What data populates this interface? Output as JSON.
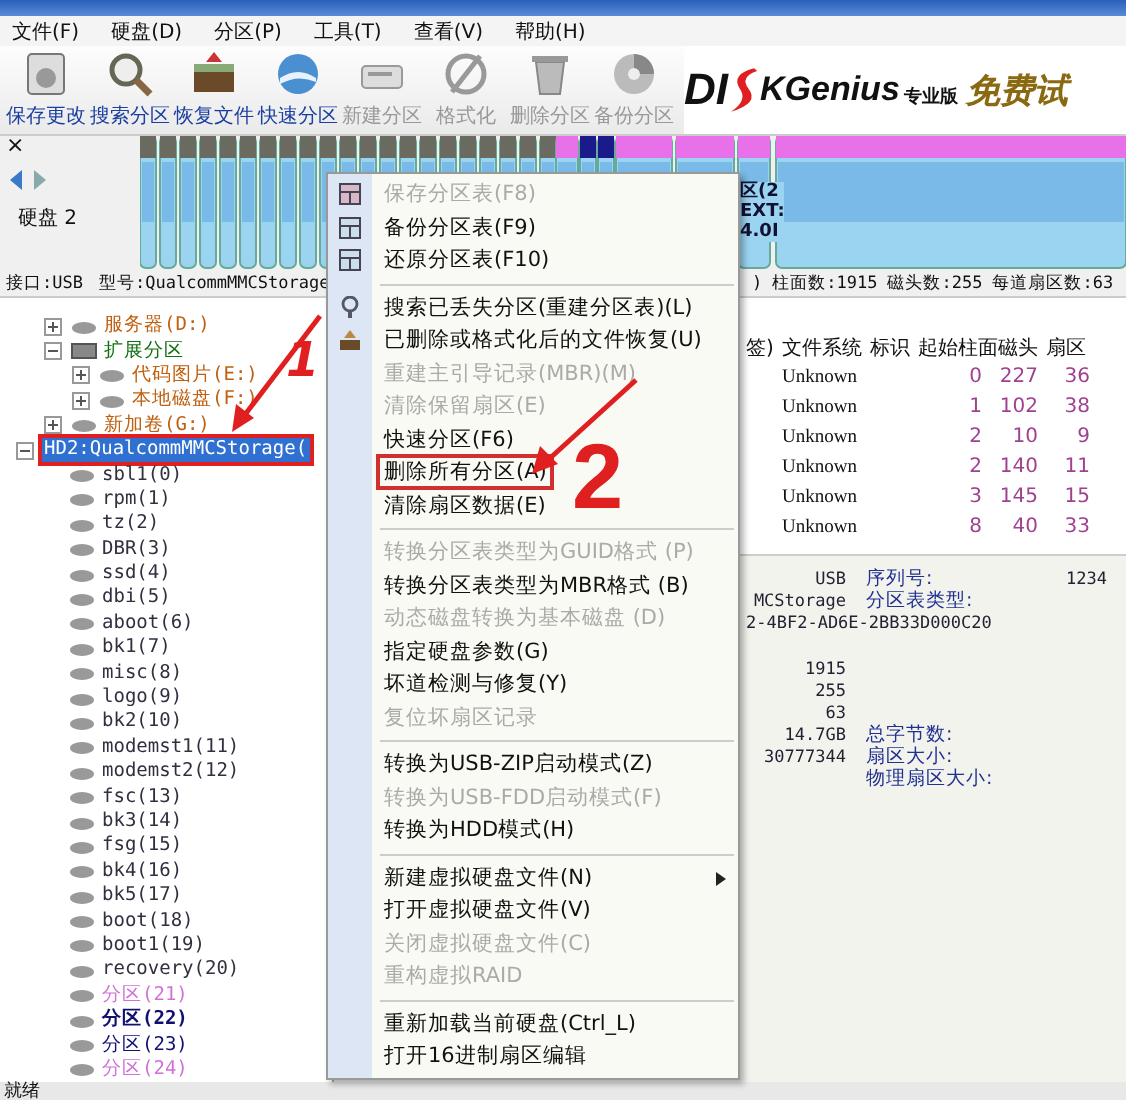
{
  "menubar": [
    "文件(F)",
    "硬盘(D)",
    "分区(P)",
    "工具(T)",
    "查看(V)",
    "帮助(H)"
  ],
  "toolbar": [
    {
      "label": "保存更改",
      "disabled": false
    },
    {
      "label": "搜索分区",
      "disabled": false
    },
    {
      "label": "恢复文件",
      "disabled": false
    },
    {
      "label": "快速分区",
      "disabled": false
    },
    {
      "label": "新建分区",
      "disabled": true
    },
    {
      "label": "格式化",
      "disabled": true
    },
    {
      "label": "删除分区",
      "disabled": true
    },
    {
      "label": "备份分区",
      "disabled": true
    }
  ],
  "logo": {
    "part_1": "DI",
    "part_2": "KGenius",
    "edition": "专业版",
    "badge": "免费试"
  },
  "disk_bar": {
    "close": "×",
    "disk_label": "硬盘 2",
    "segment_label": [
      "区(2",
      "EXT:",
      "4.0I"
    ]
  },
  "info_line": {
    "interface": "接口:USB",
    "model": "型号:QualcommMMCStorage",
    "fragment": ")",
    "cylinders": "柱面数:1915",
    "heads": "磁头数:255",
    "sectors": "每道扇区数:63"
  },
  "tree": {
    "partial_items": [
      {
        "label": "服务器(D:)",
        "color": "#c06010",
        "selected": false,
        "boxed": false,
        "expanded": false
      },
      {
        "label": "扩展分区",
        "color": "#107010",
        "selected": false,
        "boxed": false,
        "expanded": true,
        "children": [
          {
            "label": "代码图片(E:)",
            "color": "#c06010",
            "selected": false,
            "boxed": false,
            "expanded": false
          },
          {
            "label": "本地磁盘(F:)",
            "color": "#c06010",
            "selected": false,
            "boxed": false,
            "expanded": false
          }
        ]
      },
      {
        "label": "新加卷(G:)",
        "color": "#c06010",
        "selected": false,
        "boxed": false,
        "expanded": false
      }
    ],
    "disks": [
      {
        "label": "HD2:QualcommMMCStorage(",
        "selected": true,
        "boxed": true,
        "expanded": true,
        "children": [
          {
            "label": "sbl1(0)",
            "color": "#303040",
            "selected": false,
            "boxed": false
          },
          {
            "label": "rpm(1)",
            "color": "#303040",
            "selected": false,
            "boxed": false
          },
          {
            "label": "tz(2)",
            "color": "#303040",
            "selected": false,
            "boxed": false
          },
          {
            "label": "DBR(3)",
            "color": "#303040",
            "selected": false,
            "boxed": false
          },
          {
            "label": "ssd(4)",
            "color": "#303040",
            "selected": false,
            "boxed": false
          },
          {
            "label": "dbi(5)",
            "color": "#303040",
            "selected": false,
            "boxed": false
          },
          {
            "label": "aboot(6)",
            "color": "#303040",
            "selected": false,
            "boxed": false
          },
          {
            "label": "bk1(7)",
            "color": "#303040",
            "selected": false,
            "boxed": false
          },
          {
            "label": "misc(8)",
            "color": "#303040",
            "selected": false,
            "boxed": false
          },
          {
            "label": "logo(9)",
            "color": "#303040",
            "selected": false,
            "boxed": false
          },
          {
            "label": "bk2(10)",
            "color": "#303040",
            "selected": false,
            "boxed": false
          },
          {
            "label": "modemst1(11)",
            "color": "#303040",
            "selected": false,
            "boxed": false
          },
          {
            "label": "modemst2(12)",
            "color": "#303040",
            "selected": false,
            "boxed": false
          },
          {
            "label": "fsc(13)",
            "color": "#303040",
            "selected": false,
            "boxed": false
          },
          {
            "label": "bk3(14)",
            "color": "#303040",
            "selected": false,
            "boxed": false
          },
          {
            "label": "fsg(15)",
            "color": "#303040",
            "selected": false,
            "boxed": false
          },
          {
            "label": "bk4(16)",
            "color": "#303040",
            "selected": false,
            "boxed": false
          },
          {
            "label": "bk5(17)",
            "color": "#303040",
            "selected": false,
            "boxed": false
          },
          {
            "label": "boot(18)",
            "color": "#303040",
            "selected": false,
            "boxed": false
          },
          {
            "label": "boot1(19)",
            "color": "#303040",
            "selected": false,
            "boxed": false
          },
          {
            "label": "recovery(20)",
            "color": "#303040",
            "selected": false,
            "boxed": false
          },
          {
            "label": "分区(21)",
            "color": "#d070d8",
            "selected": false,
            "boxed": false
          },
          {
            "label": "分区(22)",
            "color": "#101070",
            "selected": false,
            "boxed": false
          },
          {
            "label": "分区(23)",
            "color": "#101070",
            "selected": false,
            "boxed": false
          },
          {
            "label": "分区(24)",
            "color": "#d070d8",
            "selected": false,
            "boxed": false
          }
        ]
      }
    ]
  },
  "table": {
    "columns": [
      "签)",
      "文件系统",
      "标识",
      "起始柱面",
      "磁头",
      "扇区"
    ],
    "rows": [
      [
        "",
        "Unknown",
        "",
        "0",
        "227",
        "36"
      ],
      [
        "",
        "Unknown",
        "",
        "1",
        "102",
        "38"
      ],
      [
        "",
        "Unknown",
        "",
        "2",
        "10",
        "9"
      ],
      [
        "",
        "Unknown",
        "",
        "2",
        "140",
        "11"
      ],
      [
        "",
        "Unknown",
        "",
        "3",
        "145",
        "15"
      ],
      [
        "",
        "Unknown",
        "",
        "8",
        "40",
        "33"
      ]
    ]
  },
  "details": [
    {
      "value": "USB",
      "label": "序列号:",
      "extra": "1234"
    },
    {
      "value": "MCStorage",
      "label": "分区表类型:"
    },
    {
      "value": "2-4BF2-AD6E-2BB33D000C20"
    },
    {
      "value": "1915"
    },
    {
      "value": "255"
    },
    {
      "value": "63"
    },
    {
      "value": "14.7GB",
      "label": "总字节数:"
    },
    {
      "value": "30777344",
      "label": "扇区大小:"
    },
    {
      "label": "物理扇区大小:"
    }
  ],
  "context_menu": [
    [
      {
        "label": "保存分区表(F8)",
        "disabled": true,
        "boxed": false,
        "submenu": false
      },
      {
        "label": "备份分区表(F9)",
        "disabled": false,
        "boxed": false,
        "submenu": false
      },
      {
        "label": "还原分区表(F10)",
        "disabled": false,
        "boxed": false,
        "submenu": false
      }
    ],
    [
      {
        "label": "搜索已丢失分区(重建分区表)(L)",
        "disabled": false,
        "boxed": false,
        "submenu": false
      },
      {
        "label": "已删除或格式化后的文件恢复(U)",
        "disabled": false,
        "boxed": false,
        "submenu": false
      },
      {
        "label": "重建主引导记录(MBR)(M)",
        "disabled": true,
        "boxed": false,
        "submenu": false
      },
      {
        "label": "清除保留扇区(E)",
        "disabled": true,
        "boxed": false,
        "submenu": false
      },
      {
        "label": "快速分区(F6)",
        "disabled": false,
        "boxed": false,
        "submenu": false
      },
      {
        "label": "删除所有分区(A)",
        "disabled": false,
        "boxed": true,
        "submenu": false
      },
      {
        "label": "清除扇区数据(E)",
        "disabled": false,
        "boxed": false,
        "submenu": false
      }
    ],
    [
      {
        "label": "转换分区表类型为GUID格式 (P)",
        "disabled": true,
        "boxed": false,
        "submenu": false
      },
      {
        "label": "转换分区表类型为MBR格式 (B)",
        "disabled": false,
        "boxed": false,
        "submenu": false
      },
      {
        "label": "动态磁盘转换为基本磁盘 (D)",
        "disabled": true,
        "boxed": false,
        "submenu": false
      },
      {
        "label": "指定硬盘参数(G)",
        "disabled": false,
        "boxed": false,
        "submenu": false
      },
      {
        "label": "坏道检测与修复(Y)",
        "disabled": false,
        "boxed": false,
        "submenu": false
      },
      {
        "label": "复位坏扇区记录",
        "disabled": true,
        "boxed": false,
        "submenu": false
      }
    ],
    [
      {
        "label": "转换为USB-ZIP启动模式(Z)",
        "disabled": false,
        "boxed": false,
        "submenu": false
      },
      {
        "label": "转换为USB-FDD启动模式(F)",
        "disabled": true,
        "boxed": false,
        "submenu": false
      },
      {
        "label": "转换为HDD模式(H)",
        "disabled": false,
        "boxed": false,
        "submenu": false
      }
    ],
    [
      {
        "label": "新建虚拟硬盘文件(N)",
        "disabled": false,
        "boxed": false,
        "submenu": true
      },
      {
        "label": "打开虚拟硬盘文件(V)",
        "disabled": false,
        "boxed": false,
        "submenu": false
      },
      {
        "label": "关闭虚拟硬盘文件(C)",
        "disabled": true,
        "boxed": false,
        "submenu": false
      },
      {
        "label": "重构虚拟RAID",
        "disabled": true,
        "boxed": false,
        "submenu": false
      }
    ],
    [
      {
        "label": "重新加载当前硬盘(Ctrl_L)",
        "disabled": false,
        "boxed": false,
        "submenu": false
      },
      {
        "label": "打开16进制扇区编辑",
        "disabled": false,
        "boxed": false,
        "submenu": false
      }
    ]
  ],
  "annotations": [
    "1",
    "2"
  ],
  "status_bar": "就绪"
}
